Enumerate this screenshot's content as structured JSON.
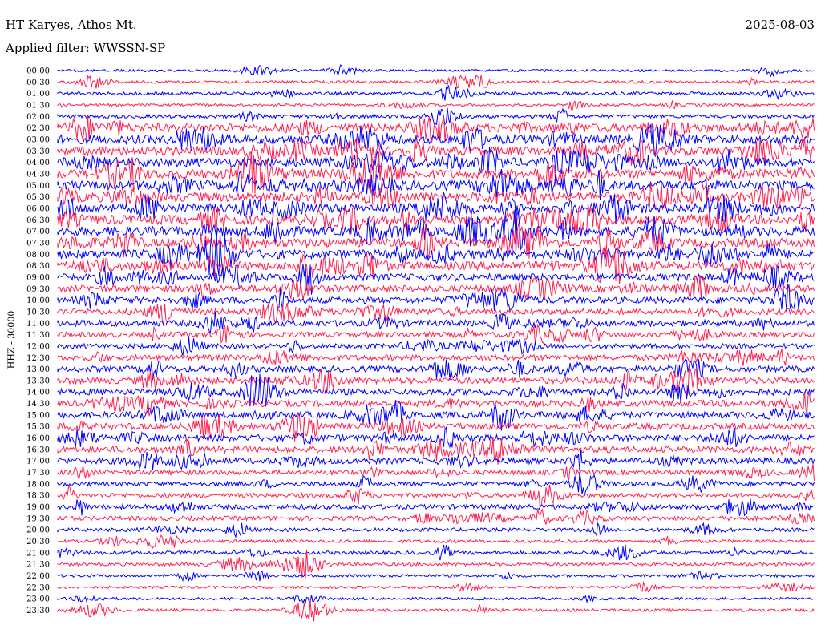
{
  "header": {
    "station": "HT Karyes, Athos Mt.",
    "date": "2025-08-03",
    "filter_label": "Applied filter: WWSSN-SP"
  },
  "chart_data": {
    "type": "line",
    "title": "HT Karyes, Athos Mt.",
    "subtitle": "Applied filter: WWSSN-SP",
    "ylabel": "HHZ - 30000",
    "date": "2025-08-03",
    "colors": [
      "#0000ff",
      "#ff1f4f"
    ],
    "rows": [
      {
        "time": "00:00",
        "activity": 0.1
      },
      {
        "time": "00:30",
        "activity": 0.15
      },
      {
        "time": "01:00",
        "activity": 0.2
      },
      {
        "time": "01:30",
        "activity": 0.12
      },
      {
        "time": "02:00",
        "activity": 0.25
      },
      {
        "time": "02:30",
        "activity": 0.85
      },
      {
        "time": "03:00",
        "activity": 0.9
      },
      {
        "time": "03:30",
        "activity": 0.9
      },
      {
        "time": "04:00",
        "activity": 0.9
      },
      {
        "time": "04:30",
        "activity": 0.95
      },
      {
        "time": "05:00",
        "activity": 0.95
      },
      {
        "time": "05:30",
        "activity": 0.95
      },
      {
        "time": "06:00",
        "activity": 0.95
      },
      {
        "time": "06:30",
        "activity": 0.95
      },
      {
        "time": "07:00",
        "activity": 0.95
      },
      {
        "time": "07:30",
        "activity": 0.9
      },
      {
        "time": "08:00",
        "activity": 0.9
      },
      {
        "time": "08:30",
        "activity": 0.85
      },
      {
        "time": "09:00",
        "activity": 0.7
      },
      {
        "time": "09:30",
        "activity": 0.65
      },
      {
        "time": "10:00",
        "activity": 0.6
      },
      {
        "time": "10:30",
        "activity": 0.55
      },
      {
        "time": "11:00",
        "activity": 0.55
      },
      {
        "time": "11:30",
        "activity": 0.45
      },
      {
        "time": "12:00",
        "activity": 0.4
      },
      {
        "time": "12:30",
        "activity": 0.5
      },
      {
        "time": "13:00",
        "activity": 0.55
      },
      {
        "time": "13:30",
        "activity": 0.6
      },
      {
        "time": "14:00",
        "activity": 0.6
      },
      {
        "time": "14:30",
        "activity": 0.6
      },
      {
        "time": "15:00",
        "activity": 0.6
      },
      {
        "time": "15:30",
        "activity": 0.6
      },
      {
        "time": "16:00",
        "activity": 0.6
      },
      {
        "time": "16:30",
        "activity": 0.6
      },
      {
        "time": "17:00",
        "activity": 0.55
      },
      {
        "time": "17:30",
        "activity": 0.4
      },
      {
        "time": "18:00",
        "activity": 0.35
      },
      {
        "time": "18:30",
        "activity": 0.35
      },
      {
        "time": "19:00",
        "activity": 0.4
      },
      {
        "time": "19:30",
        "activity": 0.35
      },
      {
        "time": "20:00",
        "activity": 0.25
      },
      {
        "time": "20:30",
        "activity": 0.2
      },
      {
        "time": "21:00",
        "activity": 0.25
      },
      {
        "time": "21:30",
        "activity": 0.2
      },
      {
        "time": "22:00",
        "activity": 0.15
      },
      {
        "time": "22:30",
        "activity": 0.12
      },
      {
        "time": "23:00",
        "activity": 0.12
      },
      {
        "time": "23:30",
        "activity": 0.15
      }
    ]
  }
}
